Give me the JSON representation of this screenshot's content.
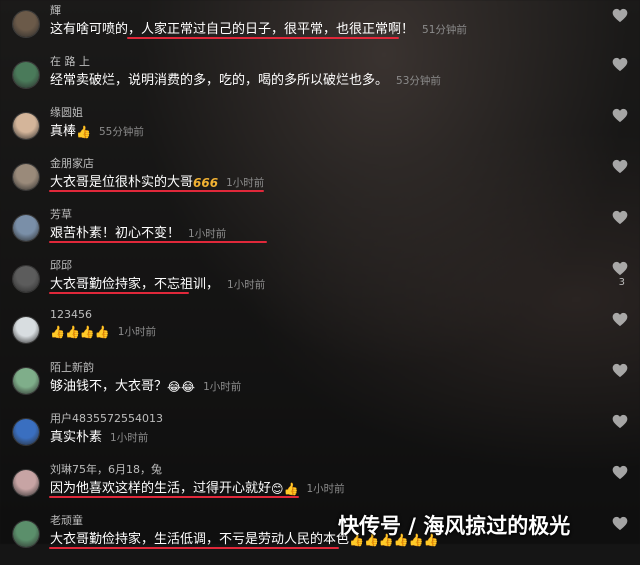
{
  "comments": [
    {
      "user": "輝",
      "text": "这有啥可喷的，人家正常过自己的日子，很平常，也很正常啊！",
      "time": "51分钟前",
      "emoji": "",
      "avatar_color": "#6b5a49"
    },
    {
      "user": "在 路 上",
      "text": "经常卖破烂，说明消费的多，吃的，喝的多所以破烂也多。",
      "time": "53分钟前",
      "emoji": "",
      "avatar_color": "#4a7a5a"
    },
    {
      "user": "缘圆姐",
      "text": "真棒",
      "time": "55分钟前",
      "emoji": "👍",
      "avatar_color": "#d4b59a"
    },
    {
      "user": "金朋家店",
      "text": "大衣哥是位很朴实的大哥",
      "time": "1小时前",
      "emoji": "666",
      "avatar_color": "#9a8a7a"
    },
    {
      "user": "芳草",
      "text": "艰苦朴素！初心不变！",
      "time": "1小时前",
      "emoji": "",
      "avatar_color": "#7a8fa8"
    },
    {
      "user": "邱邱",
      "text": "大衣哥勤俭持家，不忘祖训，",
      "time": "1小时前",
      "emoji": "",
      "avatar_color": "#5c5c5c"
    },
    {
      "user": "123456",
      "text": "",
      "time": "1小时前",
      "emoji": "👍👍👍👍",
      "avatar_color": "#d8dde0"
    },
    {
      "user": "陌上新韵",
      "text": "够油钱不，大衣哥？",
      "time": "1小时前",
      "emoji": "😂😂",
      "avatar_color": "#7fae8a"
    },
    {
      "user": "用户4835572554013",
      "text": "真实朴素",
      "time": "1小时前",
      "emoji": "",
      "avatar_color": "#3a6fc0"
    },
    {
      "user": "刘琳75年，6月18，兔",
      "text": "因为他喜欢这样的生活，过得开心就好",
      "time": "1小时前",
      "emoji": "😊👍",
      "avatar_color": "#c7a4a4"
    },
    {
      "user": "老顽童",
      "text": "大衣哥勤俭持家，生活低调，不亏是劳动人民的本色",
      "time": "",
      "emoji": "👍👍👍👍👍👍",
      "avatar_color": "#5b8f6b"
    }
  ],
  "like_counts": {
    "comment_6": "3"
  },
  "watermark": "快传号 / 海风掠过的极光",
  "colors": {
    "underline": "#e0283a",
    "background": "#151515"
  }
}
